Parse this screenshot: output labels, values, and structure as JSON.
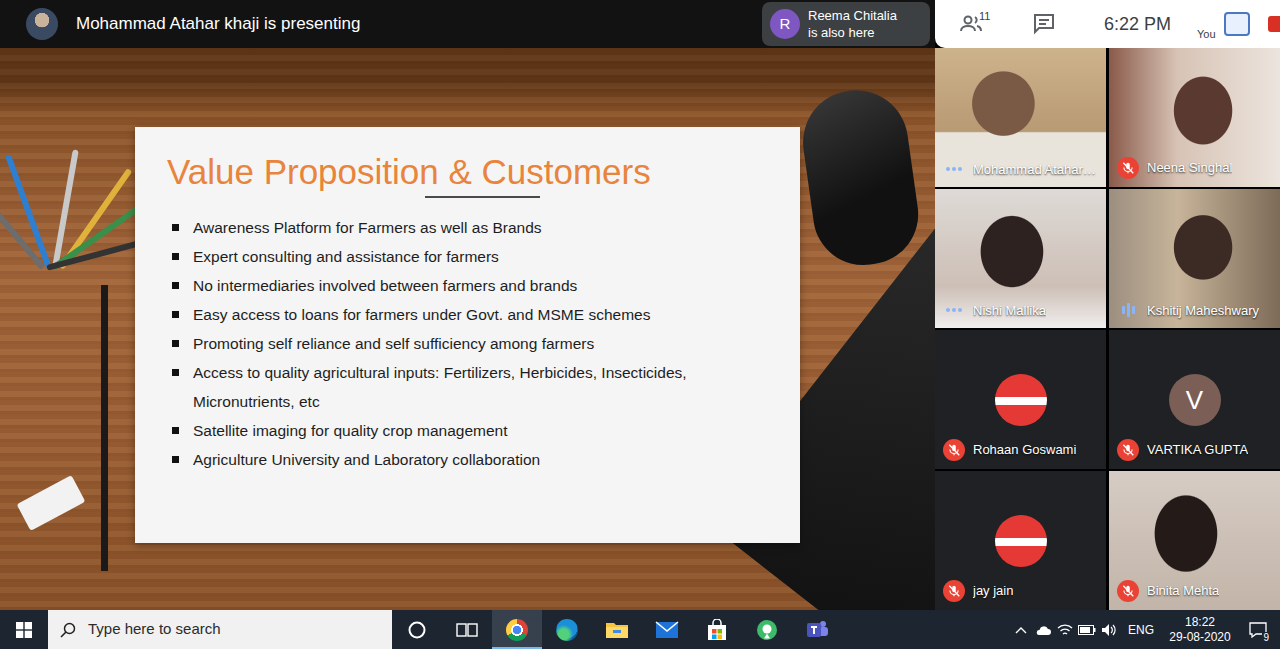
{
  "topbar": {
    "presenting": "Mohammad Atahar khaji is presenting"
  },
  "notification": {
    "initial": "R",
    "name": "Reema Chitalia",
    "text": "is also here"
  },
  "header": {
    "people_count": "11",
    "time": "6:22 PM",
    "self_label": "You"
  },
  "slide": {
    "title": "Value Proposition & Customers",
    "bullets": [
      "Awareness Platform for Farmers as well as Brands",
      "Expert consulting and assistance for farmers",
      "No intermediaries involved between farmers and brands",
      "Easy access to loans for farmers under Govt. and MSME schemes",
      "Promoting self reliance and self sufficiency among farmers",
      "Access to quality agricultural inputs: Fertilizers, Herbicides, Insecticides, Micronutrients, etc",
      "Satellite imaging for quality crop management",
      "Agriculture University and Laboratory collaboration"
    ]
  },
  "participants": [
    {
      "name": "Mohammad Atahar…",
      "kind": "video",
      "muted": false,
      "speaking": false
    },
    {
      "name": "Neena Singhal",
      "kind": "video",
      "muted": true,
      "speaking": false
    },
    {
      "name": "Nishi Mallika",
      "kind": "video",
      "muted": false,
      "speaking": false
    },
    {
      "name": "Kshitij Maheshwary",
      "kind": "video",
      "muted": false,
      "speaking": true
    },
    {
      "name": "Rohaan Goswami",
      "kind": "picture",
      "muted": true,
      "speaking": false
    },
    {
      "name": "VARTIKA GUPTA",
      "kind": "initial",
      "initial": "V",
      "muted": true,
      "speaking": false
    },
    {
      "name": "jay jain",
      "kind": "picture",
      "muted": true,
      "speaking": false
    },
    {
      "name": "Binita Mehta",
      "kind": "video",
      "muted": true,
      "speaking": false
    }
  ],
  "taskbar": {
    "search": {
      "placeholder": "Type here to search"
    },
    "buttons": [
      {
        "selected": false
      },
      {
        "selected": false
      },
      {
        "selected": true
      },
      {
        "selected": false
      },
      {
        "selected": false
      },
      {
        "selected": false
      },
      {
        "selected": false
      },
      {
        "selected": false
      },
      {
        "selected": false
      }
    ],
    "language": "ENG",
    "time": "18:22",
    "date": "29-08-2020",
    "notifications": "9"
  }
}
